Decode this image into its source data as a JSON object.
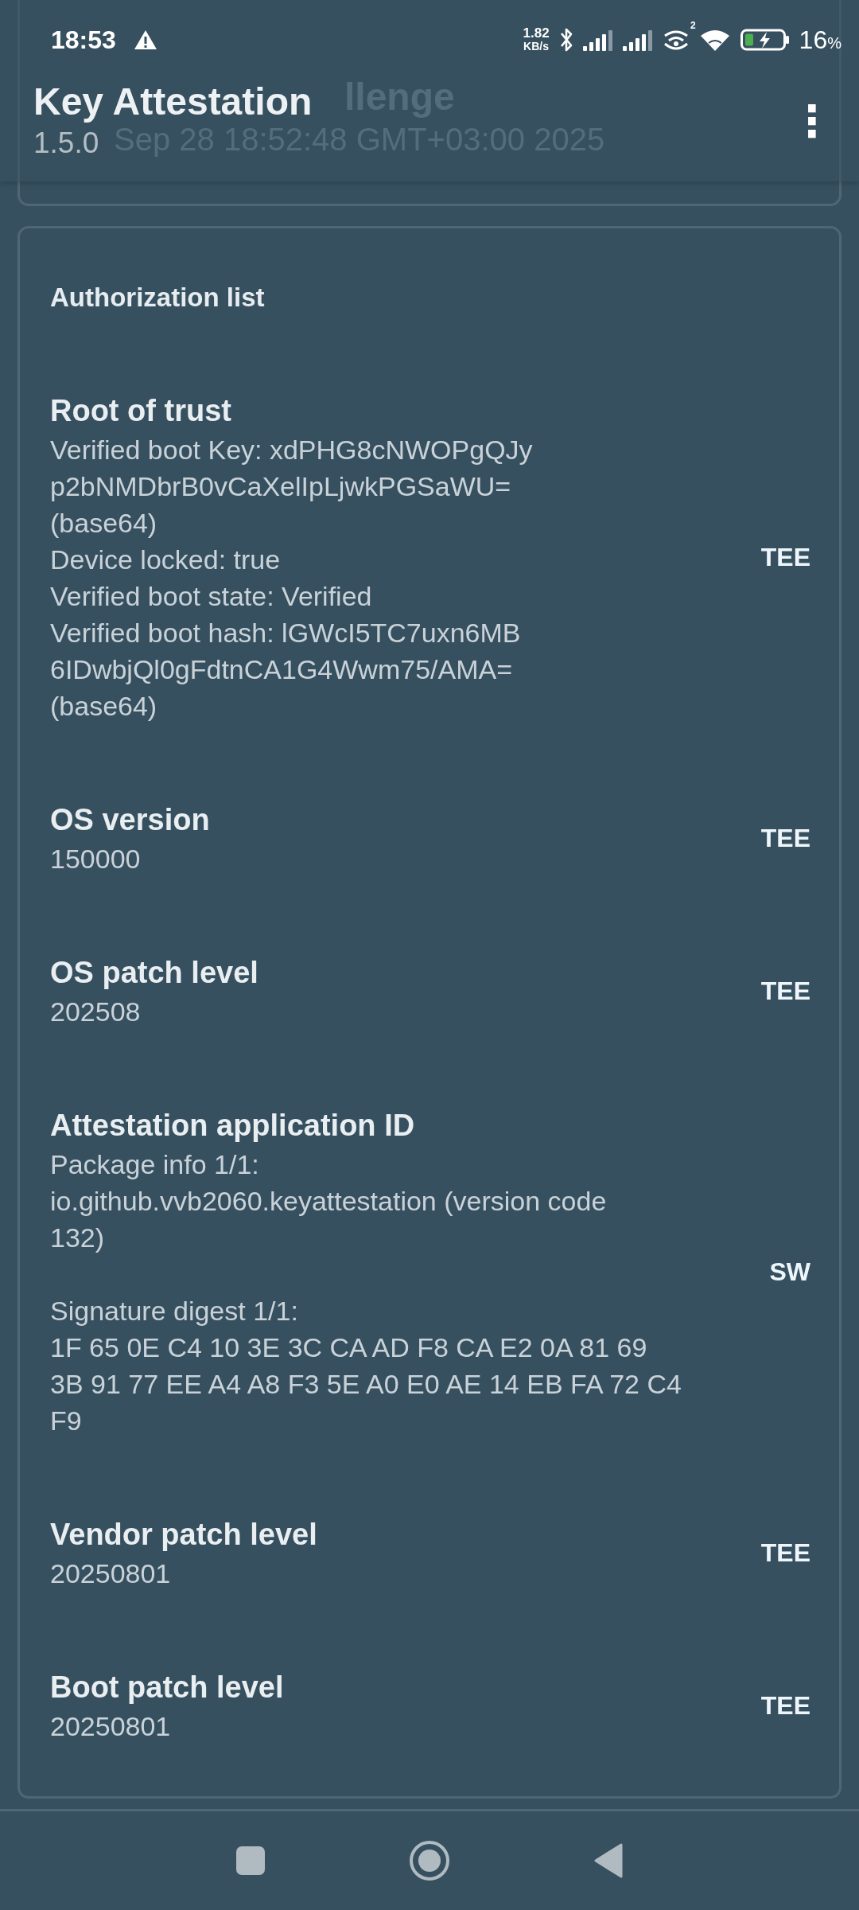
{
  "status_bar": {
    "time": "18:53",
    "net_speed_value": "1.82",
    "net_speed_unit": "KB/s",
    "sim2_label": "2",
    "battery_percent": "16",
    "battery_unit": "%"
  },
  "app_bar": {
    "title": "Key Attestation",
    "subtitle": "1.5.0",
    "menu_icon": "⋮"
  },
  "challenge_card": {
    "title": "llenge",
    "value": "Sep 28 18:52:48 GMT+03:00 2025"
  },
  "authorization_list": {
    "heading": "Authorization list",
    "items": [
      {
        "title": "Root of trust",
        "body": "Verified boot Key: xdPHG8cNWOPgQJy\np2bNMDbrB0vCaXelIpLjwkPGSaWU=\n(base64)\nDevice locked: true\nVerified boot state: Verified\nVerified boot hash: lGWcI5TC7uxn6MB\n6IDwbjQl0gFdtnCA1G4Wwm75/AMA=\n(base64)",
        "source": "TEE"
      },
      {
        "title": "OS version",
        "body": "150000",
        "source": "TEE"
      },
      {
        "title": "OS patch level",
        "body": "202508",
        "source": "TEE"
      },
      {
        "title": "Attestation application ID",
        "body": "Package info 1/1:\nio.github.vvb2060.keyattestation (version code\n132)\n\nSignature digest 1/1:\n1F 65 0E C4 10 3E 3C CA AD F8 CA E2 0A 81 69\n3B 91 77 EE A4 A8 F3 5E A0 E0 AE 14 EB FA 72 C4\nF9",
        "source": "SW"
      },
      {
        "title": "Vendor patch level",
        "body": "20250801",
        "source": "TEE"
      },
      {
        "title": "Boot patch level",
        "body": "20250801",
        "source": "TEE"
      }
    ]
  }
}
